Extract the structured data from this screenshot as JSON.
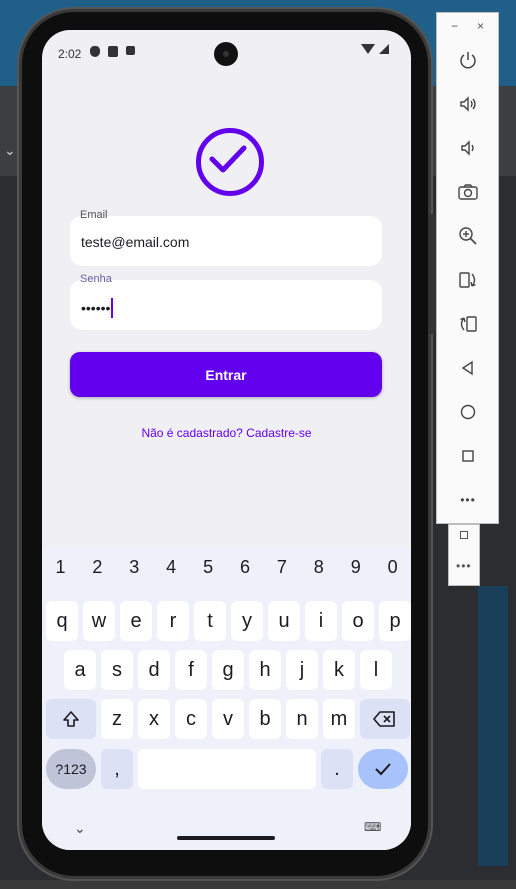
{
  "status_bar": {
    "time": "2:02"
  },
  "login": {
    "email_label": "Email",
    "email_value": "teste@email.com",
    "password_label": "Senha",
    "password_value": "••••••",
    "submit_label": "Entrar",
    "signup_link": "Não é cadastrado? Cadastre-se"
  },
  "colors": {
    "accent": "#6200ee",
    "screen_bg": "#f0eff4",
    "keyboard_bg": "#eef0fa"
  },
  "keyboard": {
    "numbers": [
      "1",
      "2",
      "3",
      "4",
      "5",
      "6",
      "7",
      "8",
      "9",
      "0"
    ],
    "row1": [
      "q",
      "w",
      "e",
      "r",
      "t",
      "y",
      "u",
      "i",
      "o",
      "p"
    ],
    "row2": [
      "a",
      "s",
      "d",
      "f",
      "g",
      "h",
      "j",
      "k",
      "l"
    ],
    "row3": [
      "z",
      "x",
      "c",
      "v",
      "b",
      "n",
      "m"
    ],
    "symbols_key": "?123",
    "comma_key": ",",
    "dot_key": "."
  },
  "emulator_toolbar": {
    "minimize": "−",
    "close": "×",
    "more": "•••",
    "icons": [
      "power-icon",
      "volume-up-icon",
      "volume-down-icon",
      "camera-icon",
      "zoom-in-icon",
      "rotate-left-icon",
      "rotate-right-icon",
      "back-icon",
      "home-icon",
      "overview-icon",
      "more-icon"
    ]
  }
}
